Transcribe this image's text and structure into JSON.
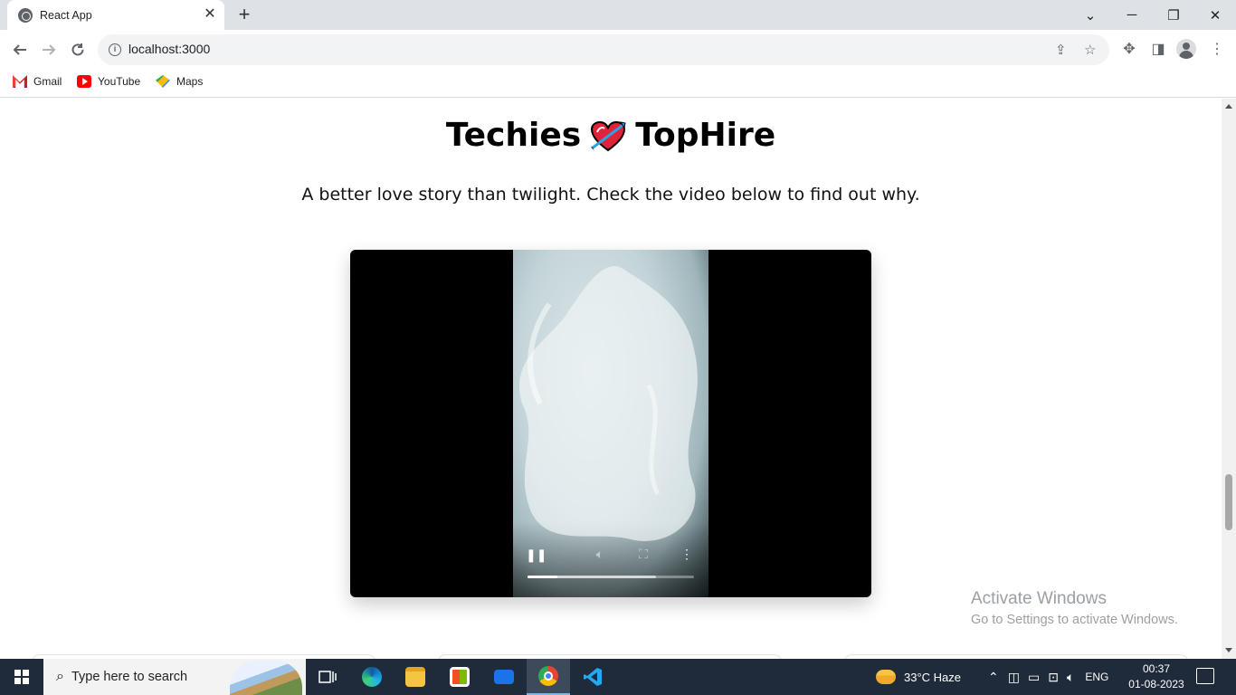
{
  "browser": {
    "tab_title": "React App",
    "tab_close": "✕",
    "new_tab": "+",
    "url": "localhost:3000",
    "window_controls": {
      "minimize": "─",
      "restore": "❐",
      "close": "✕",
      "tab_search": "⌄"
    },
    "bookmarks": [
      {
        "label": "Gmail",
        "icon": "gmail-icon"
      },
      {
        "label": "YouTube",
        "icon": "youtube-icon"
      },
      {
        "label": "Maps",
        "icon": "maps-icon"
      }
    ]
  },
  "page": {
    "title_left": "Techies",
    "title_right": "TopHire",
    "title_icon": "heart-with-arrow-icon",
    "subtitle": "A better love story than twilight. Check the video below to find out why.",
    "video": {
      "state": "playing",
      "progress_fraction": 0.18,
      "buffered_fraction": 0.77
    }
  },
  "watermark": {
    "line1": "Activate Windows",
    "line2": "Go to Settings to activate Windows."
  },
  "taskbar": {
    "search_placeholder": "Type here to search",
    "weather": "33°C  Haze",
    "language": "ENG",
    "time": "00:37",
    "date": "01-08-2023"
  }
}
